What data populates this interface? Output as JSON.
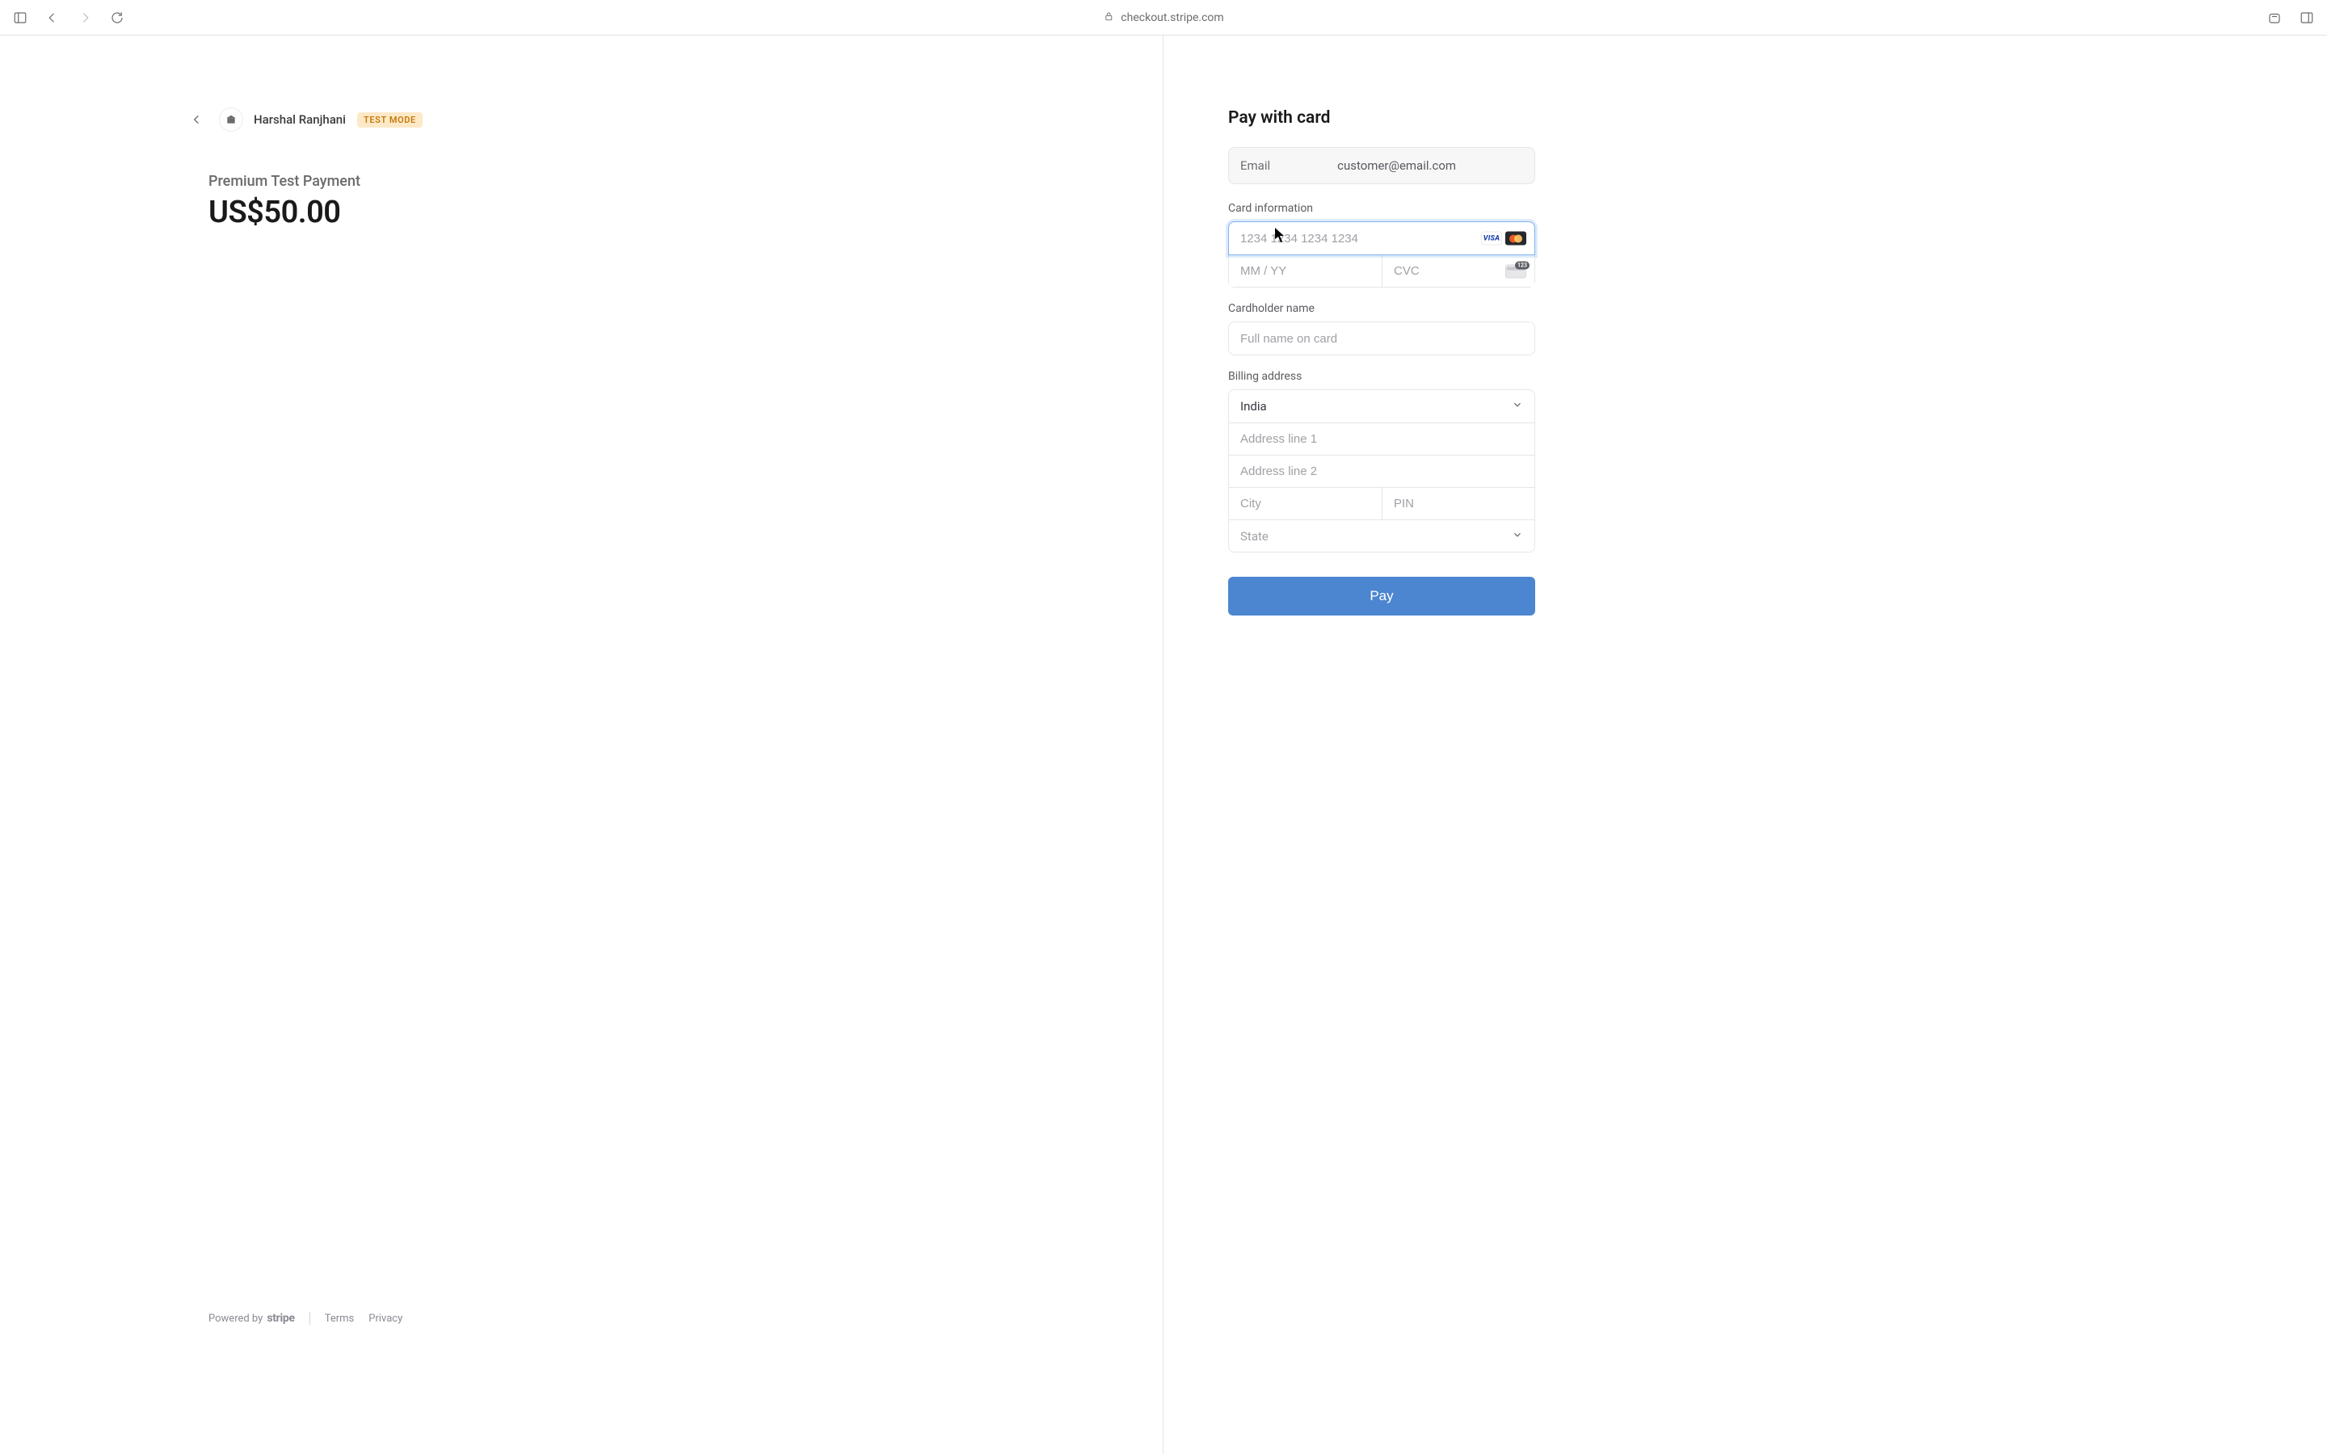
{
  "browser": {
    "url": "checkout.stripe.com"
  },
  "merchant": {
    "name": "Harshal Ranjhani",
    "badge": "TEST MODE"
  },
  "product": {
    "name": "Premium Test Payment",
    "price": "US$50.00"
  },
  "footer": {
    "powered_prefix": "Powered by",
    "brand": "stripe",
    "terms": "Terms",
    "privacy": "Privacy"
  },
  "form": {
    "title": "Pay with card",
    "email": {
      "label": "Email",
      "value": "customer@email.com"
    },
    "card": {
      "section_label": "Card information",
      "number_placeholder": "1234 1234 1234 1234",
      "expiry_placeholder": "MM / YY",
      "cvc_placeholder": "CVC"
    },
    "cardholder": {
      "section_label": "Cardholder name",
      "placeholder": "Full name on card"
    },
    "billing": {
      "section_label": "Billing address",
      "country": "India",
      "address1_placeholder": "Address line 1",
      "address2_placeholder": "Address line 2",
      "city_placeholder": "City",
      "pin_placeholder": "PIN",
      "state_placeholder": "State"
    },
    "pay_button": "Pay"
  }
}
